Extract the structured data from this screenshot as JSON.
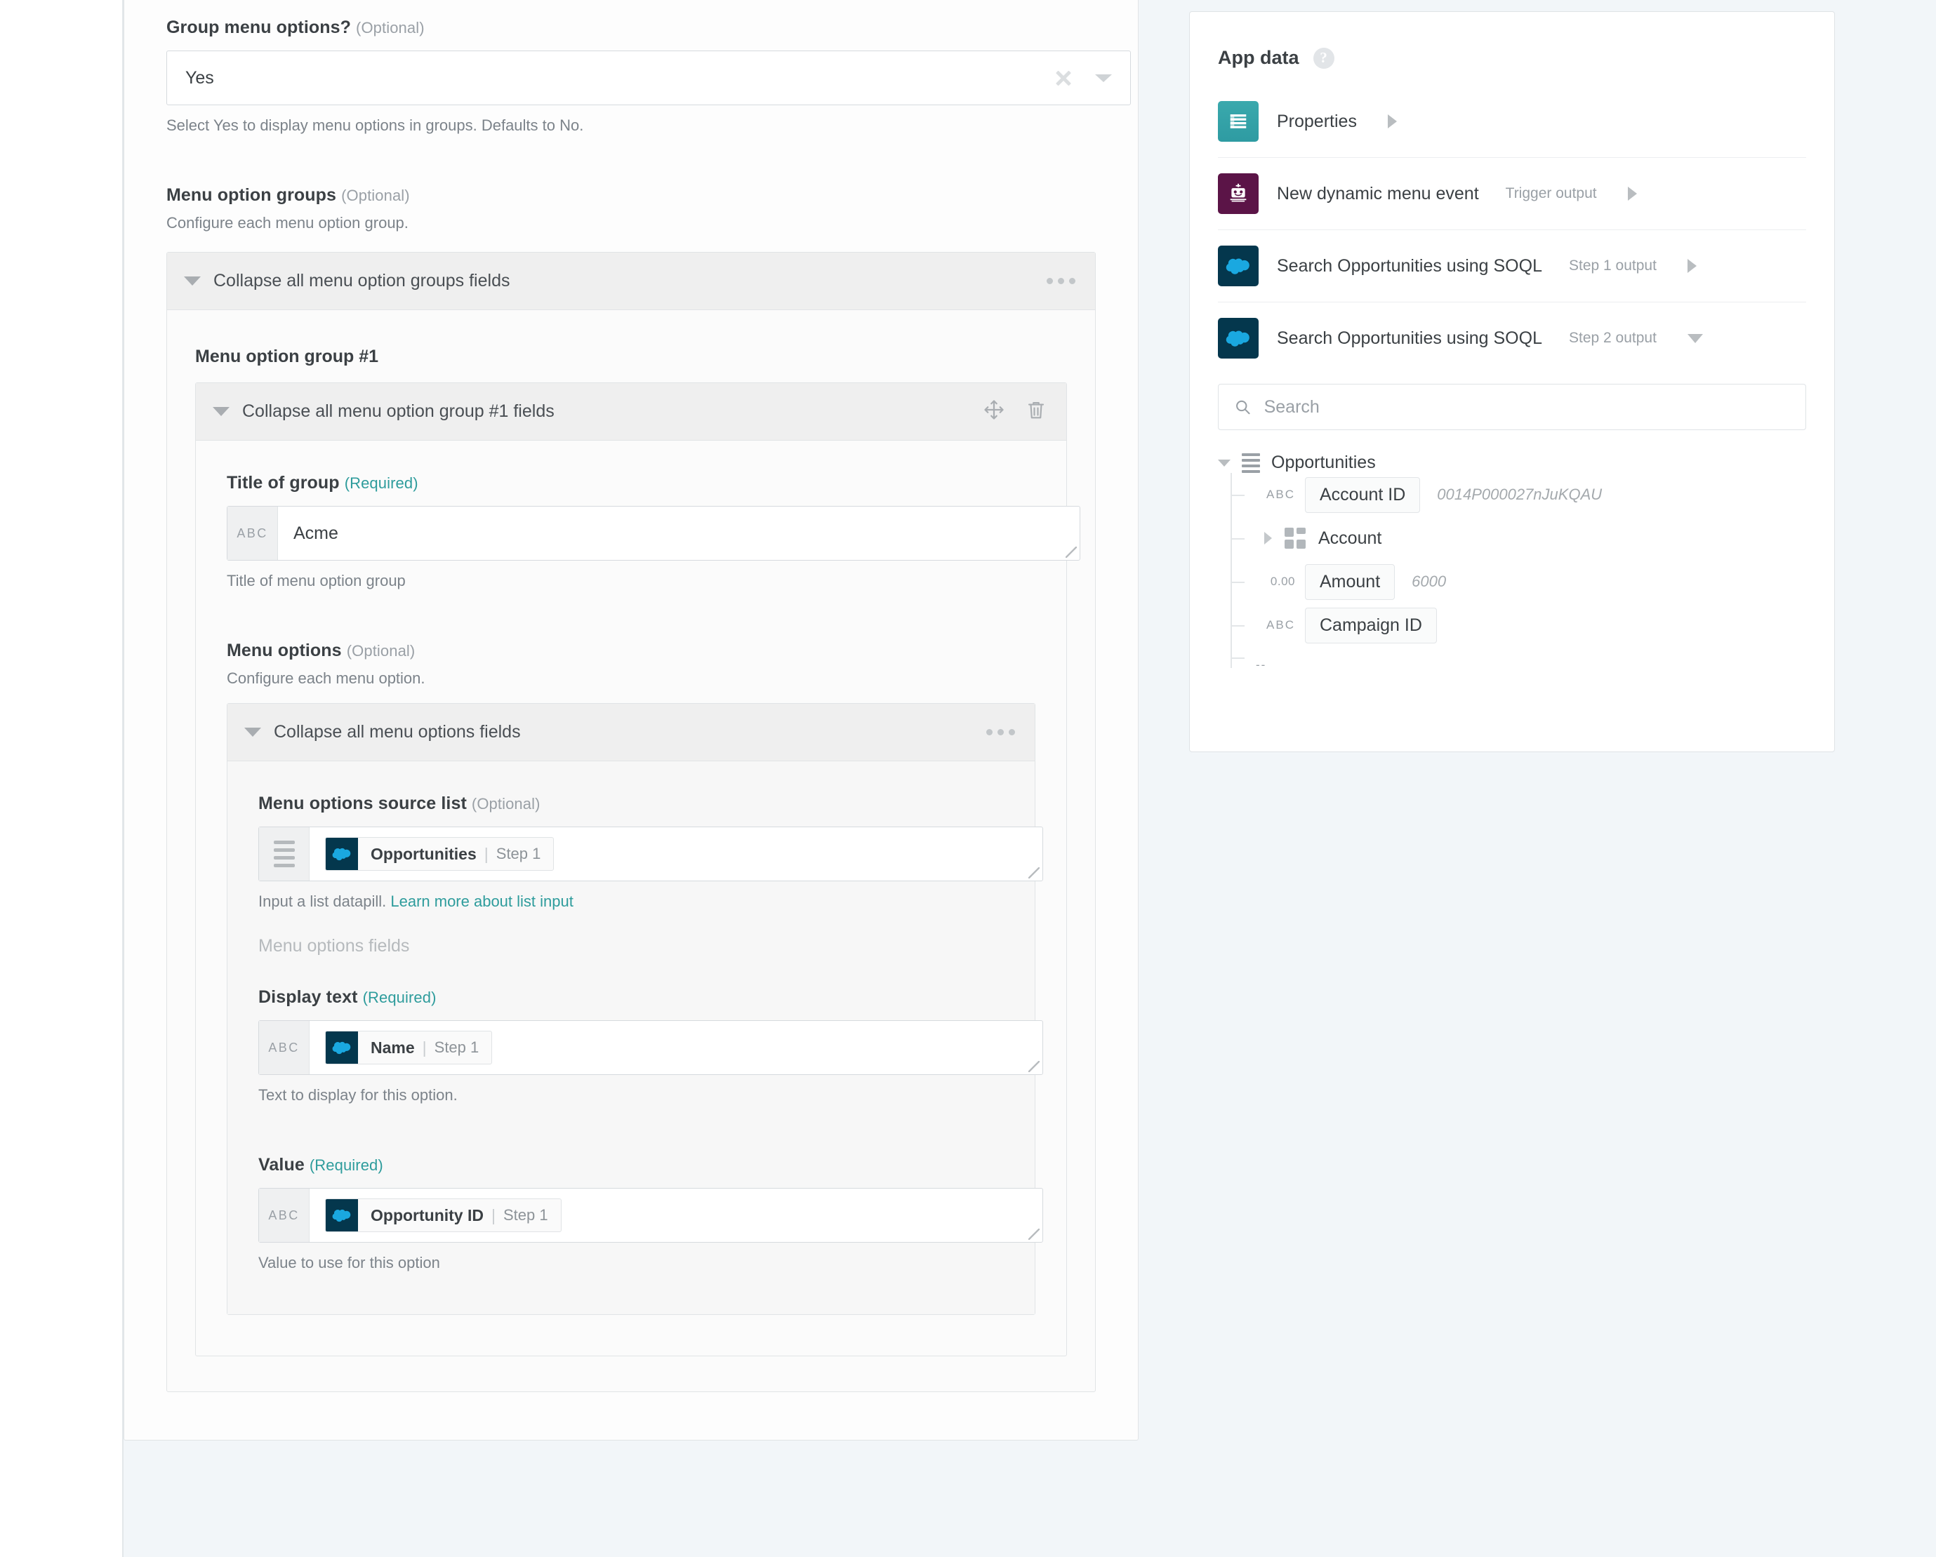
{
  "form": {
    "group_menu_options": {
      "label": "Group menu options?",
      "optional": "(Optional)",
      "value": "Yes",
      "hint": "Select Yes to display menu options in groups. Defaults to No."
    },
    "menu_option_groups": {
      "label": "Menu option groups",
      "optional": "(Optional)",
      "hint": "Configure each menu option group.",
      "panel_header": "Collapse all menu option groups fields",
      "group_label": "Menu option group #1",
      "group_panel_header": "Collapse all menu option group #1 fields"
    },
    "title_of_group": {
      "label": "Title of group",
      "required": "(Required)",
      "type_tag": "ABC",
      "value": "Acme",
      "hint": "Title of menu option group"
    },
    "menu_options": {
      "label": "Menu options",
      "optional": "(Optional)",
      "hint": "Configure each menu option.",
      "panel_header": "Collapse all menu options fields"
    },
    "source_list": {
      "label": "Menu options source list",
      "optional": "(Optional)",
      "pill_name": "Opportunities",
      "pill_sep": "|",
      "pill_step": "Step 1",
      "hint_text": "Input a list datapill.",
      "hint_link": "Learn more about list input"
    },
    "menu_options_fields_header": "Menu options fields",
    "display_text": {
      "label": "Display text",
      "required": "(Required)",
      "type_tag": "ABC",
      "pill_name": "Name",
      "pill_sep": "|",
      "pill_step": "Step 1",
      "hint": "Text to display for this option."
    },
    "value_field": {
      "label": "Value",
      "required": "(Required)",
      "type_tag": "ABC",
      "pill_name": "Opportunity ID",
      "pill_sep": "|",
      "pill_step": "Step 1",
      "hint": "Value to use for this option"
    }
  },
  "app_data": {
    "title": "App data",
    "help_glyph": "?",
    "sources": [
      {
        "name": "Properties",
        "sub": "",
        "icon": "properties-icon",
        "expander": "right"
      },
      {
        "name": "New dynamic menu event",
        "sub": "Trigger output",
        "icon": "bot-icon",
        "expander": "right"
      },
      {
        "name": "Search Opportunities using SOQL",
        "sub": "Step 1 output",
        "icon": "salesforce-icon",
        "expander": "right"
      },
      {
        "name": "Search Opportunities using SOQL",
        "sub": "Step 2 output",
        "icon": "salesforce-icon",
        "expander": "down"
      }
    ],
    "search": {
      "placeholder": "Search",
      "value": ""
    },
    "tree": {
      "root": "Opportunities",
      "nodes": [
        {
          "kind": "field",
          "type_tag": "ABC",
          "name": "Account ID",
          "value": "0014P000027nJuKQAU"
        },
        {
          "kind": "object",
          "name": "Account"
        },
        {
          "kind": "field",
          "type_tag": "0.00",
          "name": "Amount",
          "value": "6000"
        },
        {
          "kind": "field",
          "type_tag": "ABC",
          "name": "Campaign ID",
          "value": ""
        }
      ]
    }
  },
  "colors": {
    "accent_teal": "#2e9c9c",
    "salesforce_navy": "#04374d",
    "properties_teal": "#2e9ba2",
    "bot_purple": "#5b1447",
    "page_bg": "#f2f6f9"
  }
}
